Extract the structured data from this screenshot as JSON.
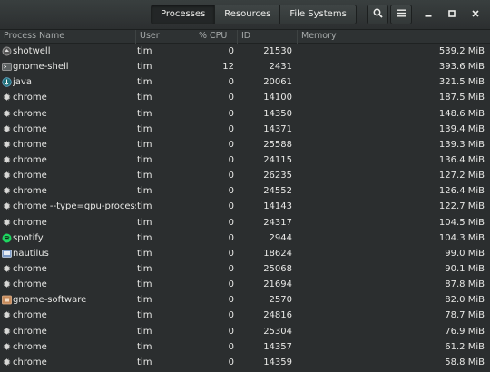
{
  "tabs": [
    "Processes",
    "Resources",
    "File Systems"
  ],
  "active_tab": "Processes",
  "columns": [
    "Process Name",
    "User",
    "% CPU",
    "ID",
    "Memory"
  ],
  "icons": {
    "search": "search-icon",
    "menu": "menu-icon",
    "minimize": "minimize-icon",
    "maximize": "maximize-icon",
    "close": "close-icon"
  },
  "processes": [
    {
      "name": "shotwell",
      "user": "tim",
      "cpu": "0",
      "id": "21530",
      "memory": "539.2 MiB",
      "icon": "shotwell"
    },
    {
      "name": "gnome-shell",
      "user": "tim",
      "cpu": "12",
      "id": "2431",
      "memory": "393.6 MiB",
      "icon": "terminal"
    },
    {
      "name": "java",
      "user": "tim",
      "cpu": "0",
      "id": "20061",
      "memory": "321.5 MiB",
      "icon": "java"
    },
    {
      "name": "chrome",
      "user": "tim",
      "cpu": "0",
      "id": "14100",
      "memory": "187.5 MiB",
      "icon": "gear"
    },
    {
      "name": "chrome",
      "user": "tim",
      "cpu": "0",
      "id": "14350",
      "memory": "148.6 MiB",
      "icon": "gear"
    },
    {
      "name": "chrome",
      "user": "tim",
      "cpu": "0",
      "id": "14371",
      "memory": "139.4 MiB",
      "icon": "gear"
    },
    {
      "name": "chrome",
      "user": "tim",
      "cpu": "0",
      "id": "25588",
      "memory": "139.3 MiB",
      "icon": "gear"
    },
    {
      "name": "chrome",
      "user": "tim",
      "cpu": "0",
      "id": "24115",
      "memory": "136.4 MiB",
      "icon": "gear"
    },
    {
      "name": "chrome",
      "user": "tim",
      "cpu": "0",
      "id": "26235",
      "memory": "127.2 MiB",
      "icon": "gear"
    },
    {
      "name": "chrome",
      "user": "tim",
      "cpu": "0",
      "id": "24552",
      "memory": "126.4 MiB",
      "icon": "gear"
    },
    {
      "name": "chrome --type=gpu-process --c",
      "user": "tim",
      "cpu": "0",
      "id": "14143",
      "memory": "122.7 MiB",
      "icon": "gear"
    },
    {
      "name": "chrome",
      "user": "tim",
      "cpu": "0",
      "id": "24317",
      "memory": "104.5 MiB",
      "icon": "gear"
    },
    {
      "name": "spotify",
      "user": "tim",
      "cpu": "0",
      "id": "2944",
      "memory": "104.3 MiB",
      "icon": "spotify"
    },
    {
      "name": "nautilus",
      "user": "tim",
      "cpu": "0",
      "id": "18624",
      "memory": "99.0 MiB",
      "icon": "nautilus"
    },
    {
      "name": "chrome",
      "user": "tim",
      "cpu": "0",
      "id": "25068",
      "memory": "90.1 MiB",
      "icon": "gear"
    },
    {
      "name": "chrome",
      "user": "tim",
      "cpu": "0",
      "id": "21694",
      "memory": "87.8 MiB",
      "icon": "gear"
    },
    {
      "name": "gnome-software",
      "user": "tim",
      "cpu": "0",
      "id": "2570",
      "memory": "82.0 MiB",
      "icon": "software"
    },
    {
      "name": "chrome",
      "user": "tim",
      "cpu": "0",
      "id": "24816",
      "memory": "78.7 MiB",
      "icon": "gear"
    },
    {
      "name": "chrome",
      "user": "tim",
      "cpu": "0",
      "id": "25304",
      "memory": "76.9 MiB",
      "icon": "gear"
    },
    {
      "name": "chrome",
      "user": "tim",
      "cpu": "0",
      "id": "14357",
      "memory": "61.2 MiB",
      "icon": "gear"
    },
    {
      "name": "chrome",
      "user": "tim",
      "cpu": "0",
      "id": "14359",
      "memory": "58.8 MiB",
      "icon": "gear"
    }
  ]
}
